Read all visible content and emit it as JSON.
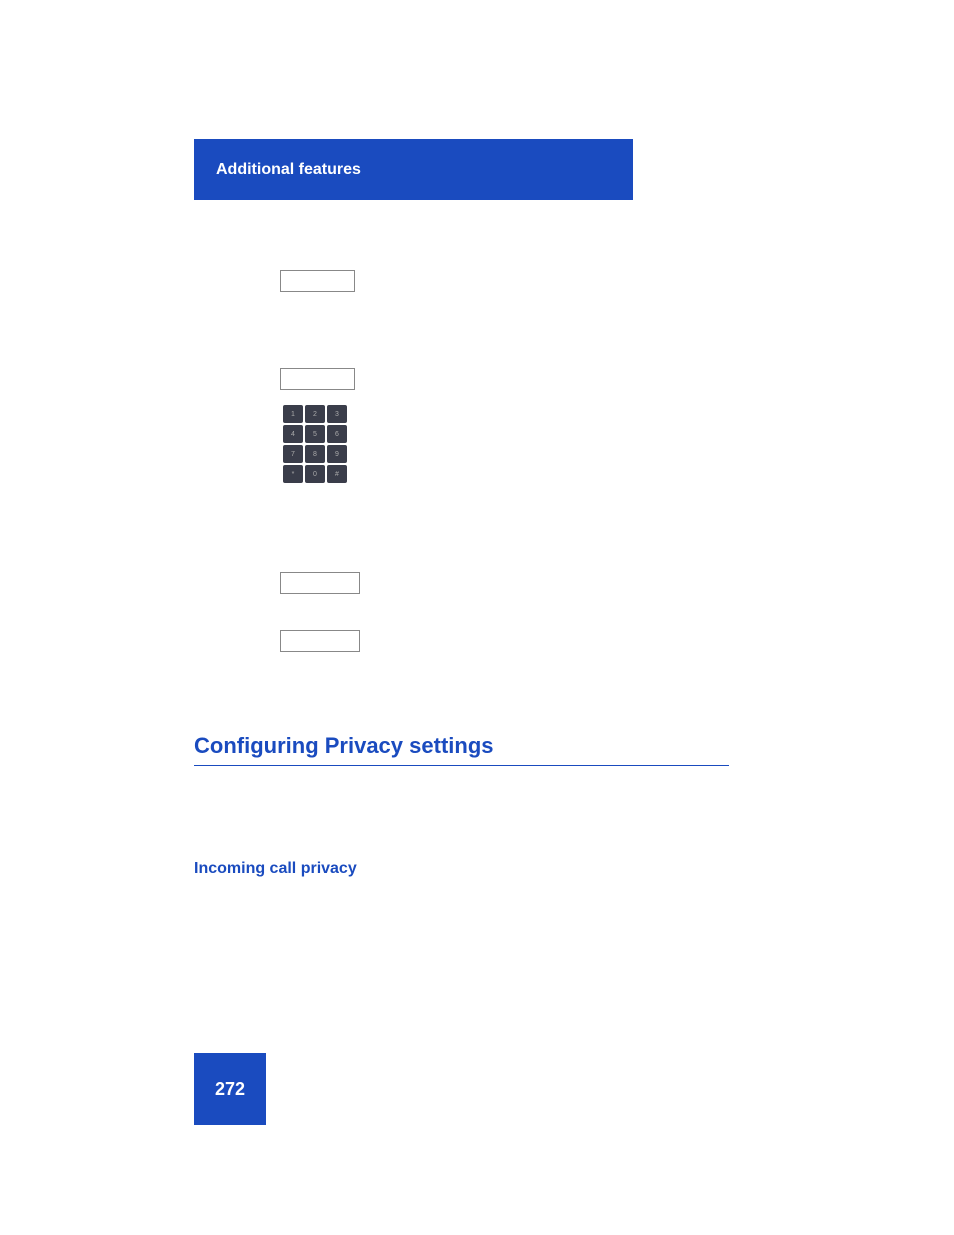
{
  "page": {
    "background": "#ffffff"
  },
  "header": {
    "text": "Additional features",
    "background": "#1a4bbf",
    "text_color": "#ffffff"
  },
  "input_boxes": [
    {
      "id": "input-1",
      "value": ""
    },
    {
      "id": "input-2",
      "value": ""
    },
    {
      "id": "input-3",
      "value": ""
    },
    {
      "id": "input-4",
      "value": ""
    }
  ],
  "keypad": {
    "rows": 4,
    "cols": 3,
    "keys": [
      "1",
      "2",
      "3",
      "4",
      "5",
      "6",
      "7",
      "8",
      "9",
      "*",
      "0",
      "#"
    ]
  },
  "section_title": "Configuring Privacy settings",
  "subsection_title": "Incoming call privacy",
  "page_number": "272"
}
